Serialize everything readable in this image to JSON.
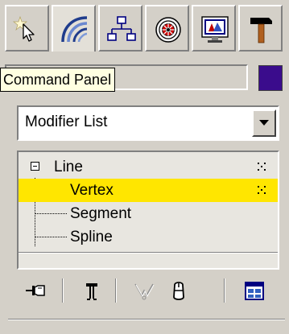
{
  "tabs": [
    {
      "icon": "create-icon",
      "active": false
    },
    {
      "icon": "modify-icon",
      "active": true
    },
    {
      "icon": "hierarchy-icon",
      "active": false
    },
    {
      "icon": "motion-icon",
      "active": false
    },
    {
      "icon": "display-icon",
      "active": false
    },
    {
      "icon": "utilities-icon",
      "active": false
    }
  ],
  "tooltip": {
    "text": "Command Panel"
  },
  "object": {
    "name": "",
    "color": "#3a0c8c"
  },
  "modifier_list": {
    "selected": "Modifier List"
  },
  "stack": {
    "items": [
      {
        "label": "Line",
        "level": 0,
        "expanded": true,
        "selected": false,
        "show_dots": true
      },
      {
        "label": "Vertex",
        "level": 1,
        "selected": true,
        "show_dots": true
      },
      {
        "label": "Segment",
        "level": 1,
        "selected": false,
        "show_dots": false
      },
      {
        "label": "Spline",
        "level": 1,
        "selected": false,
        "show_dots": false
      }
    ]
  },
  "toolbar": [
    {
      "icon": "pin-stack-icon"
    },
    {
      "icon": "show-end-result-icon"
    },
    {
      "icon": "make-unique-icon",
      "disabled": true
    },
    {
      "icon": "remove-modifier-icon"
    },
    {
      "icon": "configure-modifier-sets-icon"
    }
  ]
}
